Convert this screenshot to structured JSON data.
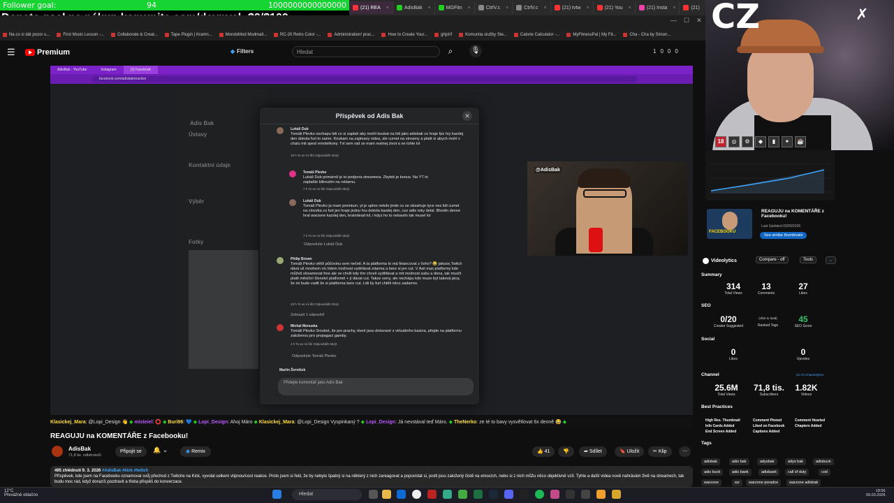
{
  "overlay": {
    "goal_left": "Follower goal:",
    "goal_mid": "94",
    "goal_right": "1000000000000000",
    "donate": "Donate goal na nákup komunita.com/deynyel: $0/$100"
  },
  "browser": {
    "tabs": [
      "(21) REA",
      "AdisBak",
      "MGFitn",
      "CtrlV.c",
      "CtrlV.c",
      "(21) tvtw",
      "(21) You",
      "(21) Insta",
      "(21)"
    ],
    "bookmarks": [
      "Na co si dát pozor u...",
      "First Music Lesson -...",
      "Collaborate & Creat...",
      "Tape Plugin | Kramn...",
      "MondoMod Modmail...",
      "RC-20 Retro Color -...",
      "Administration! prac...",
      "How to Create Your...",
      "ghjshf",
      "Komunita služby Ste...",
      "Calorie Calculator -...",
      "MyFitnessPal | My Fit...",
      "Cha - Cha by Simon..."
    ]
  },
  "yt": {
    "premium": "Premium",
    "filters": "Filters",
    "search_placeholder": "Hledat",
    "right": [
      "1",
      "0",
      "0",
      "0"
    ],
    "title": "REAGUJU na KOMENTÁŘE z Facebooku!",
    "channel": "AdisBak",
    "subs": "71,8 tis. odběratelů",
    "join": "Připojit se",
    "remix": "Remix",
    "likes": "41",
    "share": "Sdílet",
    "save": "Uložit",
    "clip": "Klip",
    "desc_meta_a": "495 zhlédnutí  9. 3. 2026 ",
    "desc_tags": "#AdisBak #kick #twitch",
    "desc_text": "Příspěvek, kde jsem na Facebooku oznamoval svůj přechod z Twitche na Kick, vyvolal celkem vtipnou/cool reakce. Proto jsem si řekl, že by nebylo špatný si na některý z nich zareagovat a popovídat si, jestli jsou založený čistě na emocích, nebo si z nich můžu něco objektivně vzít. Tyhle a další videa nově nahrávám živě na streamech, tak budu moc rád, když dorazíš pozdravit a třeba přispěš do konverzace."
  },
  "ticker": [
    {
      "u": "Klasickej_Mara",
      "m": ": @Lopi_Design 👋"
    },
    {
      "u": "misteiel",
      "m": ": ⭕"
    },
    {
      "u": "Buri96",
      "m": ": 💙"
    },
    {
      "u": "Lopi_Design",
      "m": ": Ahoj Máro"
    },
    {
      "u": "Klasickej_Mara",
      "m": ": @Lopi_Design Vyspinkaný ?"
    },
    {
      "u": "Lopi_Design",
      "m": ": Já nevstával teď Máro."
    },
    {
      "u": "TheNerko",
      "m": ": ze té to bavy vysvětlovat 6x denně 😂"
    }
  ],
  "inner": {
    "tabs": [
      "AdisBak - YouTube",
      "Instagram",
      "(2) Facebook"
    ],
    "url": "facebook.com/adisbakreactive",
    "handle": "@AdisBak",
    "side": [
      "Adis Bak",
      "Ústavy",
      "Kontaktní údaje",
      "Výběr",
      "Fotky"
    ]
  },
  "modal": {
    "title": "Příspěvek od Adis Bak",
    "c1": {
      "name": "Lukáš Dub",
      "body": "Tomáš Plevko nechapu lidi co si zaplatí aby mohli koukat na lidi jako adisbak co hraje fps hry kazdej den dokola furt to same. Koukam na zajimavy videa, ale cumet na streamy a platit si abych mohl v chatu mit spesl emotelkony. Tvl sem rad ze mam realnej zivot a ne tohle tvl",
      "meta": "19 h   To se mi líbí   Odpovědět   Skrýt"
    },
    "c2": {
      "name": "Tomáš Plevko",
      "body": "Lukáš Dub primárně je to podpora streamera. Zbytek je bonus. Na YT to zaplatíte kliknutím na reklamu.",
      "meta": "7 h   To se mi líbí   Odpovědět   Skrýt"
    },
    "c3": {
      "name": "Lukáš Dub",
      "body": "Tomáš Plevko ja mam premium. yt je uplne nekde jinde co se obsahuje tyce nez lidi cumet na cloveka co furt jen hraje jednu hru dokola kazdej den, coz adis roky delal. Bhodin denne hrat warzone kazdej den, braindead tvl, i kdyz ho to nebavilo tak musel lol",
      "meta": "7 h   To se mi líbí   Odpovědět   Skrýt"
    },
    "reply1": "Odpovězte Lukáš Dub",
    "c4": {
      "name": "Philip Brown",
      "body": "Tomáš Plevko větší půčovinu sem nečetl. A ta platforma to má financovat z čeho? 😂 jakoze,Twitch dává už mnohem víc lidem možnost vydělávat zdarma a bere si jen cut. V Asii mas platformy kde můžeš streamovat free ale ve chvíli kdy tím chceš vydělávat a mit možnost subu a dona, tak musíš platit měsíční členství platformě + jí dávat cut. Takze sorry, ale nechápu kdo muze byt taková pica, že mi bude vadit že si platforma bere cut. Lidi by furt chtěli něco zadarmo.",
      "meta": "23 h   To se mi líbí   Odpovědět   Skrýt"
    },
    "show1": "Zobrazit 1 odpověď",
    "c5": {
      "name": "Michal Menuska",
      "body": "Tomáš Plevko Smutné, že pro prachy, které jsou dotované z virtuálního kasina, přejde na platformu založenou pro propagaci gamby.",
      "meta": "4 h   To se mi líbí   Odpovědět   Skrýt"
    },
    "reply2": "Odpovězte Tomáš Plevko",
    "c6name": "Martin Švrníček",
    "input": "Přidejte komentář jako Adis Bak"
  },
  "cam": {
    "brand": "CZ",
    "badge": "18"
  },
  "right": {
    "thumb_title": "REAGUJU na KOMENTÁŘE z Facebooku!",
    "thumb_text": "FACEBOOKU",
    "updated": "Last Updated 03/09/2026",
    "see_all": "See similar thumbnails",
    "vl": "Videolytics",
    "compare": "Compare - off",
    "tools": "Tools",
    "summary": "Summary",
    "views": "314",
    "views_l": "Total Views",
    "comments": "13",
    "comments_l": "Comments",
    "likes": "27",
    "likes_l": "Likes",
    "seo": "SEO",
    "creator": "0/20",
    "creator_l": "Creator Suggested",
    "ranked": "(click to load)",
    "ranked_l": "Ranked Tags",
    "score": "45",
    "score_l": "SEO Score",
    "social": "Social",
    "s_likes": "0",
    "s_likes_l": "Likes",
    "s_up": "0",
    "s_up_l": "Upvotes",
    "channel": "Channel",
    "goto": "Go To Channelytics",
    "c_views": "25.6M",
    "c_views_l": "Total Views",
    "c_subs": "71,8 tis.",
    "c_subs_l": "Subscribers",
    "c_videos": "1.82K",
    "c_videos_l": "Videos",
    "bp": "Best Practices",
    "bp_items": [
      "High Res. Thumbnail",
      "Comment Pinned",
      "Comment Hearted",
      "Info Cards Added",
      "Liked on Facebook",
      "Chapters Added",
      "End Screen Added",
      "Captions Added"
    ],
    "tags": "Tags",
    "tag_items": [
      "adisbak",
      "adis bak",
      "adysbak",
      "adys bak",
      "adisbuck",
      "adis buck",
      "adis baek",
      "adisbaek",
      "call of duty",
      "cod",
      "warzone",
      "wz",
      "warzone poradce",
      "warzone adisbak"
    ]
  },
  "taskbar": {
    "temp": "12°C",
    "weather": "Převážně oblačno",
    "search": "Hledat",
    "time": "18:56",
    "date": "09.03.2026"
  }
}
